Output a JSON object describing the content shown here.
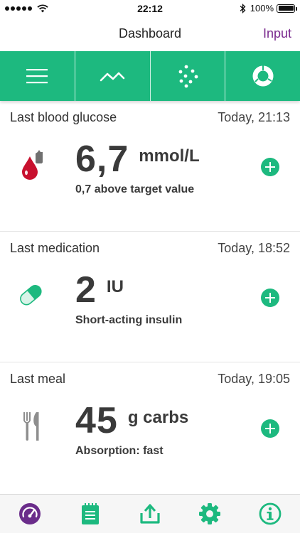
{
  "status_bar": {
    "time": "22:12",
    "battery": "100%"
  },
  "nav": {
    "title": "Dashboard",
    "action_label": "Input"
  },
  "colors": {
    "accent_green": "#1db97f",
    "accent_purple": "#7a2a8e",
    "blood_red": "#c8102e"
  },
  "view_tabs": [
    {
      "icon": "menu-icon"
    },
    {
      "icon": "line-chart-icon"
    },
    {
      "icon": "scatter-plot-icon"
    },
    {
      "icon": "ring-chart-icon"
    }
  ],
  "cards": {
    "glucose": {
      "title": "Last blood glucose",
      "time": "Today, 21:13",
      "value": "6,7",
      "unit": "mmol/L",
      "sub": "0,7 above target value",
      "icon": "blood-drop-icon"
    },
    "medication": {
      "title": "Last medication",
      "time": "Today, 18:52",
      "value": "2",
      "unit": "IU",
      "sub": "Short-acting insulin",
      "icon": "pill-icon"
    },
    "meal": {
      "title": "Last meal",
      "time": "Today, 19:05",
      "value": "45",
      "unit": "g carbs",
      "sub": "Absorption: fast",
      "icon": "cutlery-icon"
    }
  },
  "tab_bar": [
    {
      "icon": "speedometer-icon",
      "selected": true
    },
    {
      "icon": "notebook-icon"
    },
    {
      "icon": "share-upload-icon"
    },
    {
      "icon": "settings-gear-icon"
    },
    {
      "icon": "info-icon"
    }
  ]
}
